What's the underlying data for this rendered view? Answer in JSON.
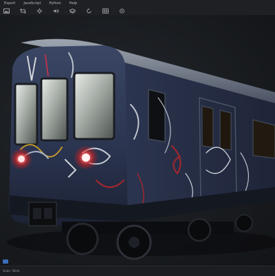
{
  "app": {
    "menu": [
      {
        "label": "Export"
      },
      {
        "label": "JavaScript"
      },
      {
        "label": "Python"
      },
      {
        "label": "Help"
      }
    ],
    "toolbar_icons": [
      "image-icon",
      "crop-icon",
      "settings-icon",
      "audio-icon",
      "layers-icon",
      "rotate-icon",
      "grid-icon",
      "target-icon"
    ]
  },
  "status": {
    "text": "Scale: 50cm"
  },
  "colors": {
    "train_body": "#2e3a55",
    "train_dark": "#1a1e2a",
    "headlight": "#ff3b3b",
    "graffiti_red": "#b3262a",
    "graffiti_yellow": "#d4a52b"
  }
}
